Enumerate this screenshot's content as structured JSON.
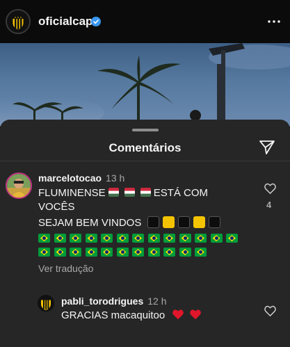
{
  "post_header": {
    "username": "oficialcap",
    "verified_icon": "verified-badge-icon",
    "more_icon": "more-horizontal-icon"
  },
  "sheet": {
    "title": "Comentários",
    "send_icon": "send-icon"
  },
  "comments": [
    {
      "username": "marcelotocao",
      "time": "13 h",
      "line1_prefix": "FLUMINENSE",
      "line1_suffix": "ESTÁ COM",
      "line2": "VOCÊS",
      "line3": "SEJAM BEM VINDOS",
      "translate_label": "Ver tradução",
      "likes": "4",
      "emoji": {
        "line1": [
          "hungary-flag",
          "hungary-flag",
          "hungary-flag"
        ],
        "line3": [
          "black-square",
          "yellow-square",
          "black-square",
          "yellow-square",
          "black-square"
        ],
        "brazil_flags_row1": 13,
        "brazil_flags_row2": 11
      }
    }
  ],
  "reply": {
    "username": "pabli_torodrigues",
    "time": "12 h",
    "text": "GRACIAS macaquitoo",
    "emoji": [
      "red-heart",
      "red-heart"
    ]
  },
  "colors": {
    "sheet_bg": "#262626",
    "secondary_text": "#a8a8a8",
    "brand_yellow": "#f5c400"
  }
}
